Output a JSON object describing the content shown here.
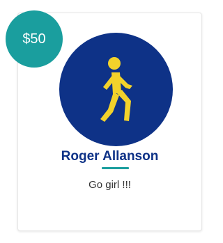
{
  "donation": {
    "amount": "$50",
    "donor_name": "Roger Allanson",
    "message": "Go girl !!!",
    "avatar_icon": "walking-person-icon"
  },
  "colors": {
    "badge": "#1a9e9e",
    "avatar_background": "#0e3287",
    "avatar_icon": "#f2d22b",
    "donor_name": "#0e3287",
    "divider": "#1a9e9e"
  }
}
